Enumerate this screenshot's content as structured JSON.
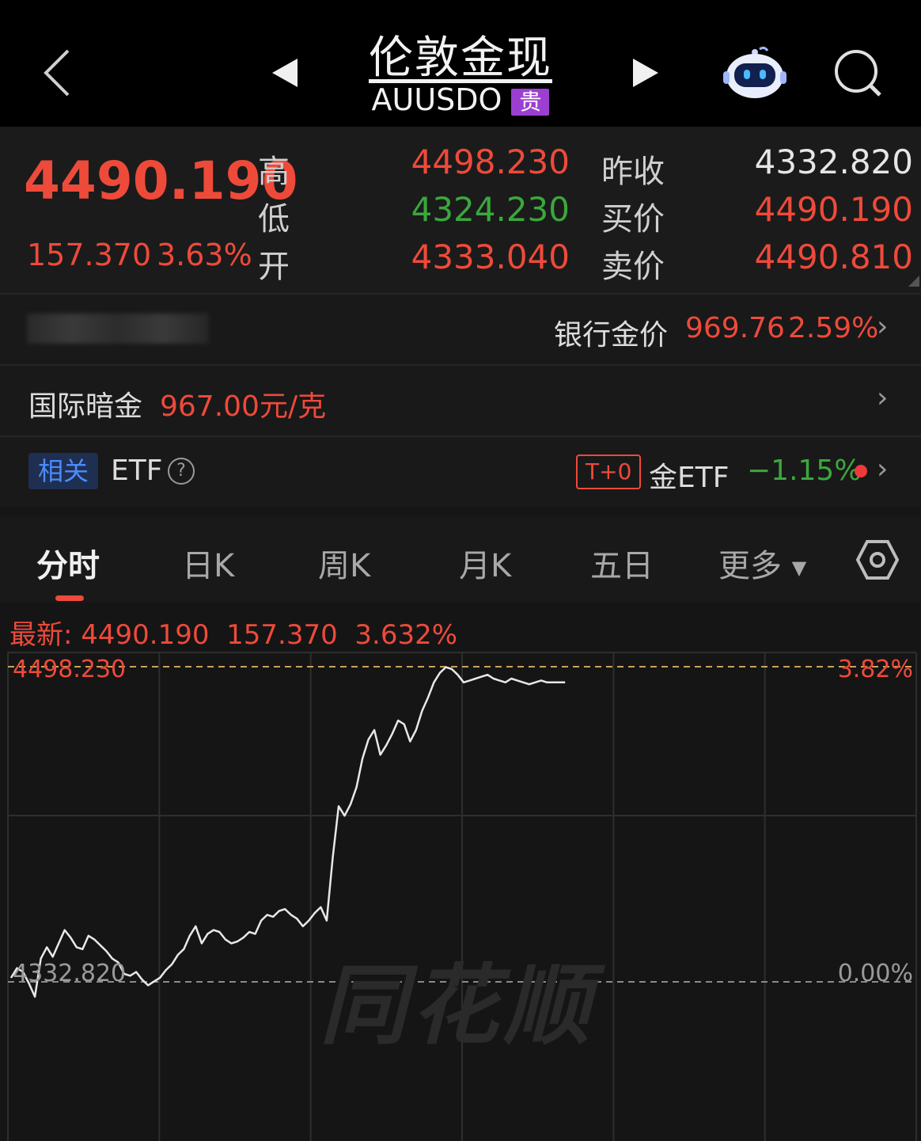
{
  "header": {
    "title": "伦敦金现",
    "code": "AUUSDO",
    "badge": "贵"
  },
  "quote": {
    "price": "4490.190",
    "change": "157.370",
    "change_pct": "3.63%",
    "high_label": "高",
    "high": "4498.230",
    "low_label": "低",
    "low": "4324.230",
    "open_label": "开",
    "open": "4333.040",
    "prev_close_label": "昨收",
    "prev_close": "4332.820",
    "bid_label": "买价",
    "bid": "4490.190",
    "ask_label": "卖价",
    "ask": "4490.810"
  },
  "bank_gold": {
    "label": "银行金价",
    "price": "969.76",
    "change_pct": "2.59%"
  },
  "intl_dark": {
    "label": "国际暗金",
    "price": "967.00元/克"
  },
  "etf": {
    "related_badge": "相关",
    "label": "ETF",
    "help": "?",
    "t0_badge": "T+0",
    "name": "金ETF",
    "change_pct": "−1.15%"
  },
  "tabs": [
    "分时",
    "日K",
    "周K",
    "月K",
    "五日",
    "更多"
  ],
  "chart_info": {
    "latest_label": "最新:",
    "latest_price": "4490.190",
    "latest_change": "157.370",
    "latest_pct": "3.632%",
    "max_price_label": "4498.230",
    "max_pct_label": "3.82%",
    "base_price_label": "4332.820",
    "base_pct_label": "0.00%",
    "watermark": "同花顺"
  },
  "colors": {
    "up": "#ee4a3a",
    "down": "#3aa83c",
    "line": "#e8e8e8",
    "purple_badge": "#9b3fd1",
    "blue_badge": "#2f6fd8"
  },
  "chart_data": {
    "type": "line",
    "ylim": [
      4324.23,
      4498.23
    ],
    "reference": 4332.82,
    "x": [
      0,
      2,
      4,
      6,
      8,
      10,
      12,
      14,
      16,
      18,
      20,
      22,
      24,
      26,
      28,
      30,
      32,
      34,
      36,
      38,
      40,
      42,
      44,
      46,
      48,
      50,
      52,
      54,
      56,
      58,
      60,
      62,
      64,
      66,
      68,
      70,
      72,
      74,
      76,
      78,
      80,
      82,
      84,
      86,
      88,
      90,
      92,
      94,
      96,
      98,
      100,
      102,
      104,
      106,
      108,
      110,
      112,
      114,
      116,
      118,
      120,
      122,
      124,
      126,
      128,
      130,
      132,
      134,
      136,
      138,
      140,
      142,
      144,
      146,
      148,
      150,
      152,
      154,
      156,
      158,
      160,
      162,
      164,
      166,
      168,
      170,
      172,
      174,
      176,
      178,
      180,
      182,
      184,
      186
    ],
    "y": [
      4335,
      4340,
      4338,
      4332,
      4325,
      4345,
      4351,
      4346,
      4353,
      4360,
      4356,
      4351,
      4350,
      4357,
      4355,
      4352,
      4349,
      4345,
      4343,
      4337,
      4336,
      4338,
      4334,
      4331,
      4333,
      4335,
      4339,
      4342,
      4347,
      4350,
      4357,
      4362,
      4353,
      4358,
      4360,
      4359,
      4355,
      4353,
      4354,
      4356,
      4359,
      4358,
      4365,
      4368,
      4367,
      4370,
      4371,
      4368,
      4366,
      4362,
      4365,
      4369,
      4372,
      4365,
      4398,
      4425,
      4420,
      4426,
      4435,
      4450,
      4460,
      4465,
      4452,
      4457,
      4463,
      4470,
      4468,
      4459,
      4465,
      4475,
      4482,
      4490,
      4495,
      4498,
      4497,
      4494,
      4490,
      4491,
      4492,
      4493,
      4494,
      4492,
      4491,
      4490,
      4492,
      4491,
      4490,
      4489,
      4490,
      4491,
      4490,
      4490,
      4490,
      4490
    ]
  }
}
